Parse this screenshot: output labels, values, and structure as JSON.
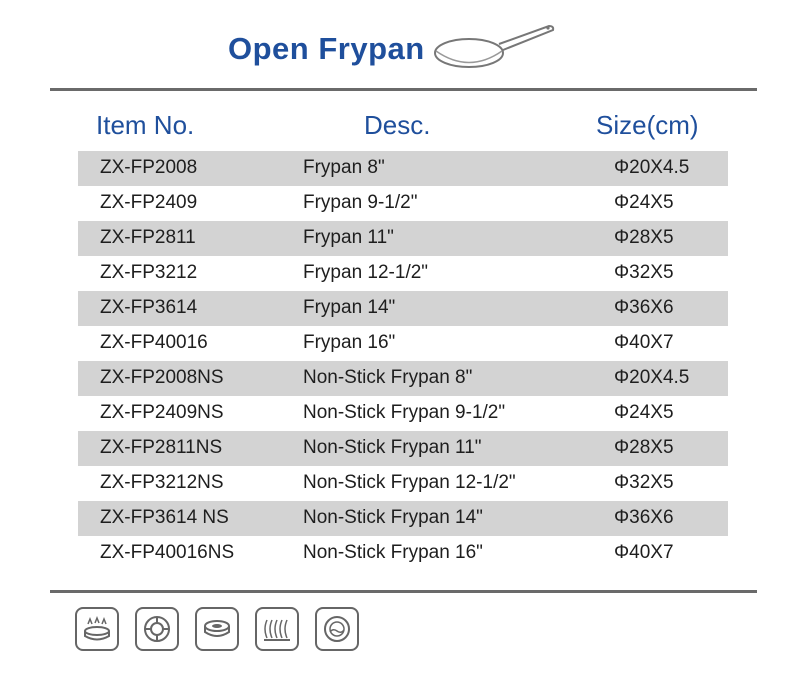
{
  "title": "Open Frypan",
  "headers": {
    "item": "Item No.",
    "desc": "Desc.",
    "size": "Size(cm)"
  },
  "rows": [
    {
      "item": "ZX-FP2008",
      "desc": "Frypan 8\"",
      "size": "Φ20X4.5"
    },
    {
      "item": "ZX-FP2409",
      "desc": "Frypan 9-1/2\"",
      "size": "Φ24X5"
    },
    {
      "item": "ZX-FP2811",
      "desc": "Frypan 11\"",
      "size": "Φ28X5"
    },
    {
      "item": "ZX-FP3212",
      "desc": "Frypan 12-1/2\"",
      "size": "Φ32X5"
    },
    {
      "item": "ZX-FP3614",
      "desc": "Frypan 14\"",
      "size": "Φ36X6"
    },
    {
      "item": "ZX-FP40016",
      "desc": "Frypan 16\"",
      "size": "Φ40X7"
    },
    {
      "item": "ZX-FP2008NS",
      "desc": "Non-Stick Frypan 8\"",
      "size": "Φ20X4.5"
    },
    {
      "item": "ZX-FP2409NS",
      "desc": "Non-Stick Frypan 9-1/2\"",
      "size": "Φ24X5"
    },
    {
      "item": "ZX-FP2811NS",
      "desc": "Non-Stick Frypan 11\"",
      "size": "Φ28X5"
    },
    {
      "item": "ZX-FP3212NS",
      "desc": "Non-Stick Frypan 12-1/2\"",
      "size": "Φ32X5"
    },
    {
      "item": "ZX-FP3614 NS",
      "desc": "Non-Stick Frypan 14\"",
      "size": "Φ36X6"
    },
    {
      "item": "ZX-FP40016NS",
      "desc": "Non-Stick Frypan 16\"",
      "size": "Φ40X7"
    }
  ],
  "colors": {
    "title": "#1f4f9c",
    "row_shade": "#d3d3d3",
    "rule": "#6a6a6a"
  },
  "icons": [
    "gas-stove-icon",
    "electric-stove-icon",
    "ceramic-hob-icon",
    "halogen-icon",
    "induction-icon"
  ]
}
